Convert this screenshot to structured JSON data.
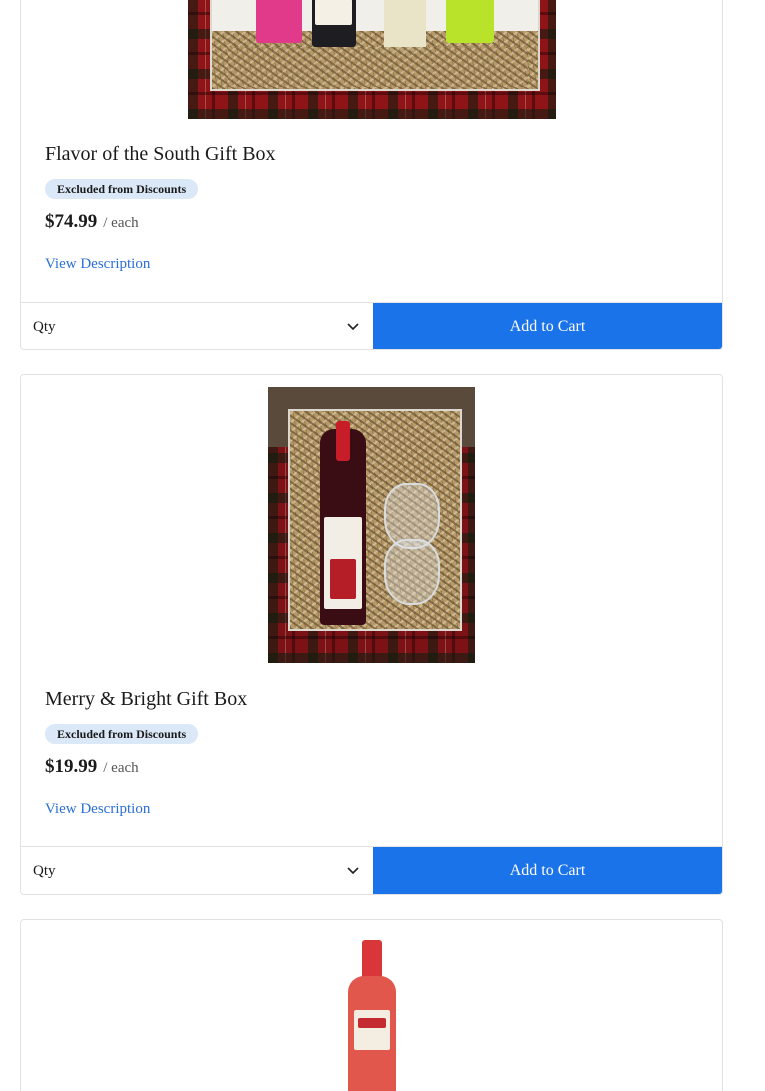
{
  "products": [
    {
      "name": "Flavor of the South Gift Box",
      "badge": "Excluded from Discounts",
      "price": "$74.99",
      "unit": "/ each",
      "view_description": "View Description",
      "qty_placeholder": "Qty",
      "add_to_cart": "Add to Cart"
    },
    {
      "name": "Merry & Bright Gift Box",
      "badge": "Excluded from Discounts",
      "price": "$19.99",
      "unit": "/ each",
      "view_description": "View Description",
      "qty_placeholder": "Qty",
      "add_to_cart": "Add to Cart"
    },
    {
      "name": "",
      "badge": "",
      "price": "",
      "unit": "",
      "view_description": "",
      "qty_placeholder": "",
      "add_to_cart": ""
    }
  ],
  "colors": {
    "accent": "#1a73e8",
    "link": "#2a6fd6",
    "badge_bg": "#dbe8f7",
    "border": "#e2e2e2"
  },
  "icons": {
    "qty_chevron": "chevron-down-icon"
  }
}
